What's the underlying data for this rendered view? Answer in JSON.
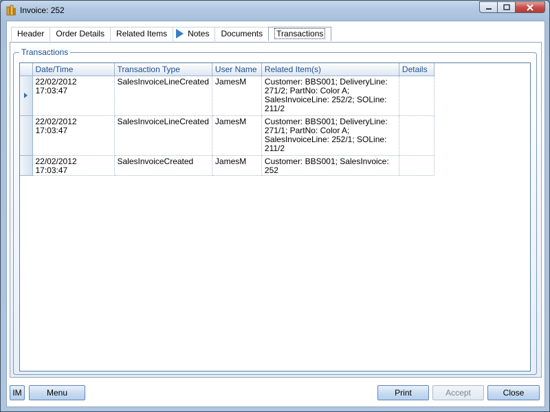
{
  "window": {
    "title": "Invoice: 252",
    "colors": {
      "frame": "#b3c9e2",
      "accent": "#3b7dc4",
      "close_button": "#c75050"
    }
  },
  "tabs": [
    {
      "label": "Header",
      "active": false
    },
    {
      "label": "Order Details",
      "active": false
    },
    {
      "label": "Related Items",
      "active": false
    },
    {
      "label": "Notes",
      "active": false,
      "icon": "play-arrow-icon"
    },
    {
      "label": "Documents",
      "active": false
    },
    {
      "label": "Transactions",
      "active": true
    }
  ],
  "group": {
    "label": "Transactions"
  },
  "grid": {
    "columns": [
      "Date/Time",
      "Transaction Type",
      "User Name",
      "Related Item(s)",
      "Details"
    ],
    "rows": [
      {
        "current": true,
        "cells": [
          "22/02/2012 17:03:47",
          "SalesInvoiceLineCreated",
          "JamesM",
          "Customer: BBS001; DeliveryLine: 271/2; PartNo: Color A; SalesInvoiceLine: 252/2; SOLine: 211/2",
          ""
        ]
      },
      {
        "current": false,
        "cells": [
          "22/02/2012 17:03:47",
          "SalesInvoiceLineCreated",
          "JamesM",
          "Customer: BBS001; DeliveryLine: 271/1; PartNo: Color A; SalesInvoiceLine: 252/1; SOLine: 211/2",
          ""
        ]
      },
      {
        "current": false,
        "cells": [
          "22/02/2012 17:03:47",
          "SalesInvoiceCreated",
          "JamesM",
          "Customer: BBS001; SalesInvoice: 252",
          ""
        ]
      }
    ]
  },
  "buttons": {
    "im": "IM",
    "menu": "Menu",
    "print": "Print",
    "accept": "Accept",
    "close": "Close"
  }
}
